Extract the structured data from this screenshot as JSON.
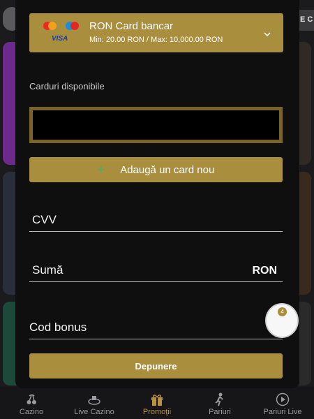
{
  "background": {
    "top_right_text": "E C"
  },
  "payment_method": {
    "title": "RON Card bancar",
    "limits": "Min: 20.00 RON / Max: 10,000.00 RON",
    "visa_text": "VISA",
    "icons": [
      "mastercard-logo",
      "maestro-logo",
      "visa-logo",
      "chevron-down-icon"
    ]
  },
  "cards": {
    "label": "Carduri disponibile",
    "add_button_label": "Adaugă un card nou"
  },
  "form": {
    "cvv_label": "CVV",
    "amount_label": "Sumă",
    "amount_currency": "RON",
    "bonus_label": "Cod bonus",
    "submit_label": "Depunere"
  },
  "chat": {
    "badge_count": "4"
  },
  "bottom_nav": {
    "items": [
      {
        "label": "Cazino",
        "icon": "cherries-icon"
      },
      {
        "label": "Live Cazino",
        "icon": "live-casino-icon"
      },
      {
        "label": "Promoţii",
        "icon": "gift-icon"
      },
      {
        "label": "Pariuri",
        "icon": "player-icon"
      },
      {
        "label": "Pariuri Live",
        "icon": "play-circle-icon"
      }
    ],
    "active_index": 2
  },
  "colors": {
    "accent": "#a98e3e",
    "panel": "#0f0f0f",
    "active_nav": "#b8923e",
    "plus_green": "#3fb36b"
  }
}
